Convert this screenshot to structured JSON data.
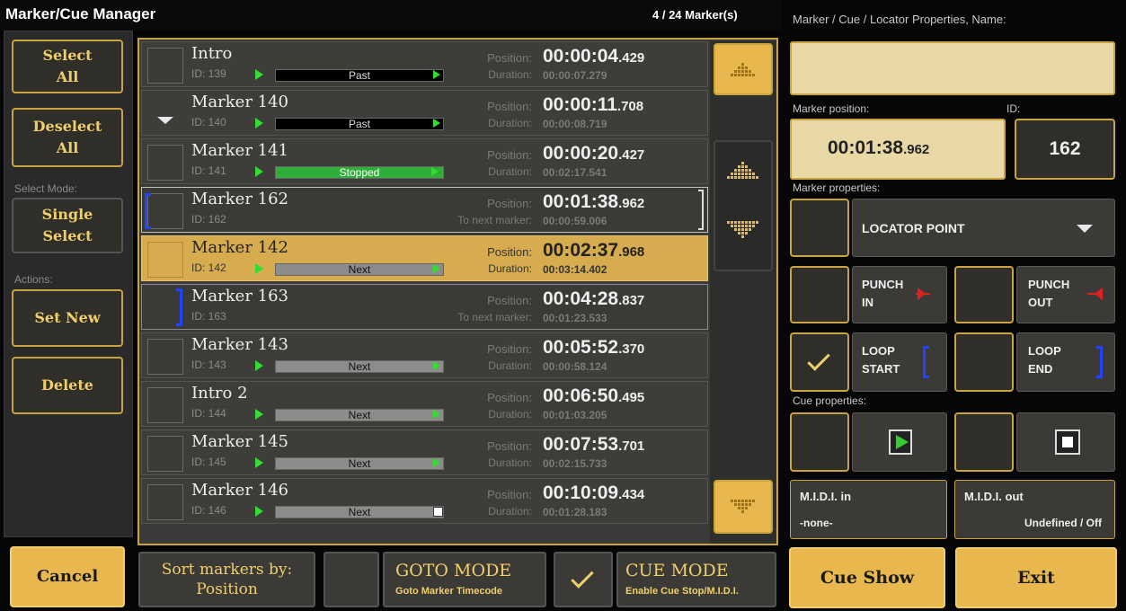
{
  "title": "Marker/Cue Manager",
  "marker_count": "4 / 24 Marker(s)",
  "properties_title": "Marker / Cue / Locator Properties, Name:",
  "left": {
    "select_all": [
      "Select",
      "All"
    ],
    "deselect_all": [
      "Deselect",
      "All"
    ],
    "select_mode_label": "Select Mode:",
    "single_select": [
      "Single",
      "Select"
    ],
    "actions_label": "Actions:",
    "set_new": "Set New",
    "delete": "Delete",
    "cancel": "Cancel"
  },
  "rows": [
    {
      "name": "Intro",
      "id": "ID: 139",
      "state": "Past",
      "pos_main": "00:00:04",
      "pos_ms": ".429",
      "dur": "00:00:07.279",
      "plabel": "Position:",
      "dlabel": "Duration:"
    },
    {
      "name": "Marker 140",
      "id": "ID: 140",
      "state": "Past",
      "pos_main": "00:00:11",
      "pos_ms": ".708",
      "dur": "00:00:08.719",
      "plabel": "Position:",
      "dlabel": "Duration:"
    },
    {
      "name": "Marker 141",
      "id": "ID: 141",
      "state": "Stopped",
      "pos_main": "00:00:20",
      "pos_ms": ".427",
      "dur": "00:02:17.541",
      "plabel": "Position:",
      "dlabel": "Duration:"
    },
    {
      "name": "Marker 162",
      "id": "ID: 162",
      "state": "",
      "pos_main": "00:01:38",
      "pos_ms": ".962",
      "dur": "00:00:59.006",
      "plabel": "Position:",
      "dlabel": "To next marker:"
    },
    {
      "name": "Marker 142",
      "id": "ID: 142",
      "state": "Next",
      "pos_main": "00:02:37",
      "pos_ms": ".968",
      "dur": "00:03:14.402",
      "plabel": "Position:",
      "dlabel": "Duration:"
    },
    {
      "name": "Marker 163",
      "id": "ID: 163",
      "state": "",
      "pos_main": "00:04:28",
      "pos_ms": ".837",
      "dur": "00:01:23.533",
      "plabel": "Position:",
      "dlabel": "To next marker:"
    },
    {
      "name": "Marker 143",
      "id": "ID: 143",
      "state": "Next",
      "pos_main": "00:05:52",
      "pos_ms": ".370",
      "dur": "00:00:58.124",
      "plabel": "Position:",
      "dlabel": "Duration:"
    },
    {
      "name": "Intro 2",
      "id": "ID: 144",
      "state": "Next",
      "pos_main": "00:06:50",
      "pos_ms": ".495",
      "dur": "00:01:03.205",
      "plabel": "Position:",
      "dlabel": "Duration:"
    },
    {
      "name": "Marker 145",
      "id": "ID: 145",
      "state": "Next",
      "pos_main": "00:07:53",
      "pos_ms": ".701",
      "dur": "00:02:15.733",
      "plabel": "Position:",
      "dlabel": "Duration:"
    },
    {
      "name": "Marker 146",
      "id": "ID: 146",
      "state": "Next",
      "pos_main": "00:10:09",
      "pos_ms": ".434",
      "dur": "00:01:28.183",
      "plabel": "Position:",
      "dlabel": "Duration:"
    }
  ],
  "bottom": {
    "sort_label": "Sort markers by:",
    "sort_value": "Position",
    "goto_title": "GOTO MODE",
    "goto_sub": "Goto Marker Timecode",
    "cue_title": "CUE MODE",
    "cue_sub": "Enable Cue Stop/M.I.D.I."
  },
  "right": {
    "marker_position_label": "Marker position:",
    "id_label": "ID:",
    "position_main": "00:01:38",
    "position_ms": ".962",
    "id_value": "162",
    "marker_properties_label": "Marker properties:",
    "type": "LOCATOR POINT",
    "punch_in": [
      "PUNCH",
      "IN"
    ],
    "punch_out": [
      "PUNCH",
      "OUT"
    ],
    "loop_start": [
      "LOOP",
      "START"
    ],
    "loop_end": [
      "LOOP",
      "END"
    ],
    "cue_properties_label": "Cue properties:",
    "midi_in_label": "M.I.D.I. in",
    "midi_in_value": "-none-",
    "midi_out_label": "M.I.D.I. out",
    "midi_out_value": "Undefined / Off",
    "cue_show": "Cue Show",
    "exit": "Exit"
  }
}
